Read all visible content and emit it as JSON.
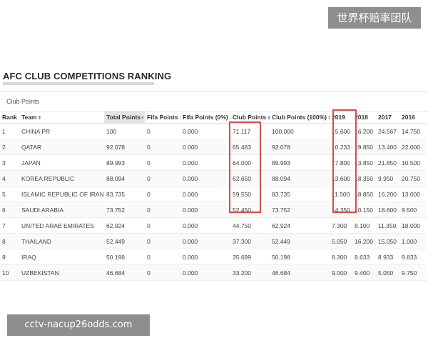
{
  "badge_text": "世界杯赔率团队",
  "heading": "AFC CLUB COMPETITIONS RANKING",
  "card_title": "Club Points",
  "columns": [
    {
      "label": "Rank"
    },
    {
      "label": "Team",
      "sort": "both"
    },
    {
      "label": "Total Points",
      "sort": "down",
      "sorted": true
    },
    {
      "label": "Fifa Points",
      "sort": "both"
    },
    {
      "label": "Fifa Points (0%)",
      "sort": "both"
    },
    {
      "label": "Club Points",
      "sort": "both"
    },
    {
      "label": "Club Points (100%)",
      "sort": "both"
    },
    {
      "label": "2019"
    },
    {
      "label": "2018"
    },
    {
      "label": "2017"
    },
    {
      "label": "2016"
    }
  ],
  "rows": [
    [
      "1",
      "CHINA PR",
      "100",
      "0",
      "0.000",
      "71.117",
      "100.000",
      "15.600",
      "16.200",
      "24.567",
      "14.750"
    ],
    [
      "2",
      "QATAR",
      "92.078",
      "0",
      "0.000",
      "65.483",
      "92.078",
      "10.233",
      "19.850",
      "13.400",
      "22.000"
    ],
    [
      "3",
      "JAPAN",
      "89.993",
      "0",
      "0.000",
      "64.000",
      "89.993",
      "17.800",
      "13.850",
      "21.850",
      "10.500"
    ],
    [
      "4",
      "KOREA REPUBLIC",
      "88.094",
      "0",
      "0.000",
      "62.650",
      "88.094",
      "13.600",
      "18.350",
      "9.950",
      "20.750"
    ],
    [
      "5",
      "ISLAMIC REPUBLIC OF IRAN",
      "83.735",
      "0",
      "0.000",
      "59.550",
      "83.735",
      "11.500",
      "18.850",
      "16.200",
      "13.000"
    ],
    [
      "6",
      "SAUDI ARABIA",
      "73.752",
      "0",
      "0.000",
      "52.450",
      "73.752",
      "14.350",
      "10.150",
      "18.600",
      "9.500"
    ],
    [
      "7",
      "UNITED ARAB EMIRATES",
      "62.924",
      "0",
      "0.000",
      "44.750",
      "62.924",
      "7.300",
      "8.100",
      "11.350",
      "18.000"
    ],
    [
      "8",
      "THAILAND",
      "52.449",
      "0",
      "0.000",
      "37.300",
      "52.449",
      "5.050",
      "16.200",
      "15.050",
      "1.000"
    ],
    [
      "9",
      "IRAQ",
      "50.198",
      "0",
      "0.000",
      "35.699",
      "50.198",
      "8.300",
      "8.633",
      "8.933",
      "9.833"
    ],
    [
      "10",
      "UZBEKISTAN",
      "46.684",
      "0",
      "0.000",
      "33.200",
      "46.684",
      "9.000",
      "9.400",
      "5.050",
      "9.750"
    ]
  ],
  "highlight_colors": {
    "box": "#d84b4b"
  },
  "watermark_text": "cctv-nacup26odds.com"
}
